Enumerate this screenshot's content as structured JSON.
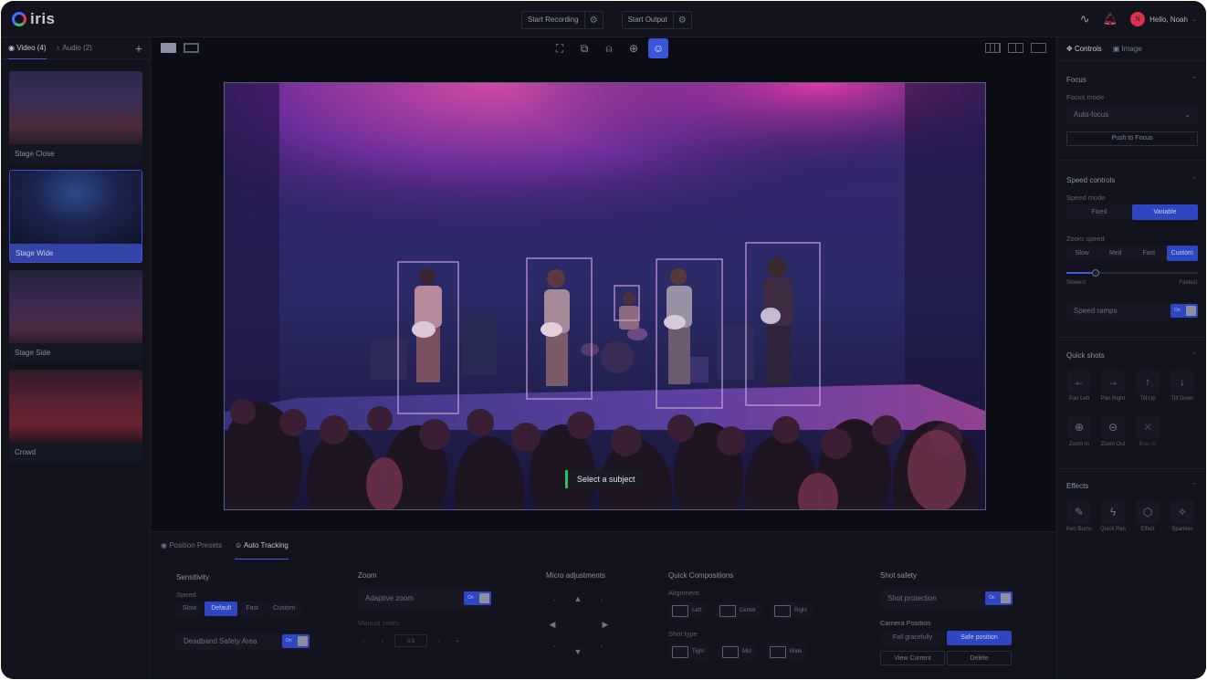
{
  "app": {
    "name": "iris"
  },
  "topbar": {
    "start_recording": "Start Recording",
    "start_output": "Start Output",
    "user_greeting": "Hello, Noah",
    "avatar_initial": "N"
  },
  "sidebar": {
    "tabs": [
      {
        "label": "Video (4)"
      },
      {
        "label": "Audio (2)"
      }
    ],
    "add": "+",
    "sources": [
      {
        "label": "Stage Close"
      },
      {
        "label": "Stage Wide"
      },
      {
        "label": "Stage Side"
      },
      {
        "label": "Crowd"
      }
    ]
  },
  "video": {
    "tooltip": "Select a subject"
  },
  "right_panel": {
    "tabs": [
      {
        "label": "Controls"
      },
      {
        "label": "Image"
      }
    ],
    "focus": {
      "title": "Focus",
      "mode_label": "Focus mode",
      "mode_value": "Auto-focus",
      "push_button": "Push to Focus"
    },
    "speed": {
      "title": "Speed controls",
      "mode_label": "Speed mode",
      "modes": [
        "Fixed",
        "Variable"
      ],
      "mode_selected": "Variable",
      "zoom_label": "Zoom speed",
      "zoom_options": [
        "Slow",
        "Med",
        "Fast",
        "Custom"
      ],
      "zoom_selected": "Custom",
      "slider_value": 0.22,
      "slider_min_label": "Slowest",
      "slider_max_label": "Fastest",
      "ramps_label": "Speed ramps",
      "ramps_state": "On"
    },
    "quick_shots": {
      "title": "Quick shots",
      "items": [
        {
          "label": "Pan Left",
          "icon": "arrow-left-icon"
        },
        {
          "label": "Pan Right",
          "icon": "arrow-right-icon"
        },
        {
          "label": "Tilt Up",
          "icon": "arrow-up-icon"
        },
        {
          "label": "Tilt Down",
          "icon": "arrow-down-icon"
        },
        {
          "label": "Zoom In",
          "icon": "zoom-in-icon"
        },
        {
          "label": "Zoom Out",
          "icon": "zoom-out-icon"
        },
        {
          "label": "Bow Ar",
          "icon": "close-icon"
        }
      ]
    },
    "effects": {
      "title": "Effects",
      "items": [
        {
          "label": "Ken Burns",
          "icon": "wand-icon"
        },
        {
          "label": "Quick Pan",
          "icon": "lightning-icon"
        },
        {
          "label": "Effect",
          "icon": "cube-icon"
        },
        {
          "label": "Sparkles",
          "icon": "sparkles-icon"
        }
      ]
    }
  },
  "bottom": {
    "tabs": [
      {
        "label": "Position Presets"
      },
      {
        "label": "Auto Tracking"
      }
    ],
    "sensitivity": {
      "title": "Sensitivity",
      "speed_label": "Speed",
      "speed_options": [
        "Slow",
        "Default",
        "Fast",
        "Custom"
      ],
      "speed_selected": "Default",
      "deadband_label": "Deadband Safety Area",
      "deadband_state": "On"
    },
    "zoom": {
      "title": "Zoom",
      "adaptive_label": "Adaptive zoom",
      "adaptive_state": "On",
      "manual_label": "Manual zoom",
      "manual_value": "0.5"
    },
    "micro": {
      "title": "Micro adjustments"
    },
    "quick_compositions": {
      "title": "Quick Compositions",
      "alignment_label": "Alignment",
      "alignment": [
        "Left",
        "Center",
        "Right"
      ],
      "shot_type_label": "Shot type",
      "shot_types": [
        "Tight",
        "Mid",
        "Wide"
      ]
    },
    "shot_safety": {
      "title": "Shot safety",
      "protection_label": "Shot protection",
      "protection_state": "On",
      "camera_position_label": "Camera Position",
      "fall_gracefully": "Fall gracefully",
      "safe_position": "Safe position",
      "view_current": "View Current",
      "delete": "Delete"
    }
  },
  "colors": {
    "accent": "#2e46c2",
    "bg": "#0f1018",
    "panel": "#12131c",
    "tracking_green": "#2fbf5c"
  }
}
